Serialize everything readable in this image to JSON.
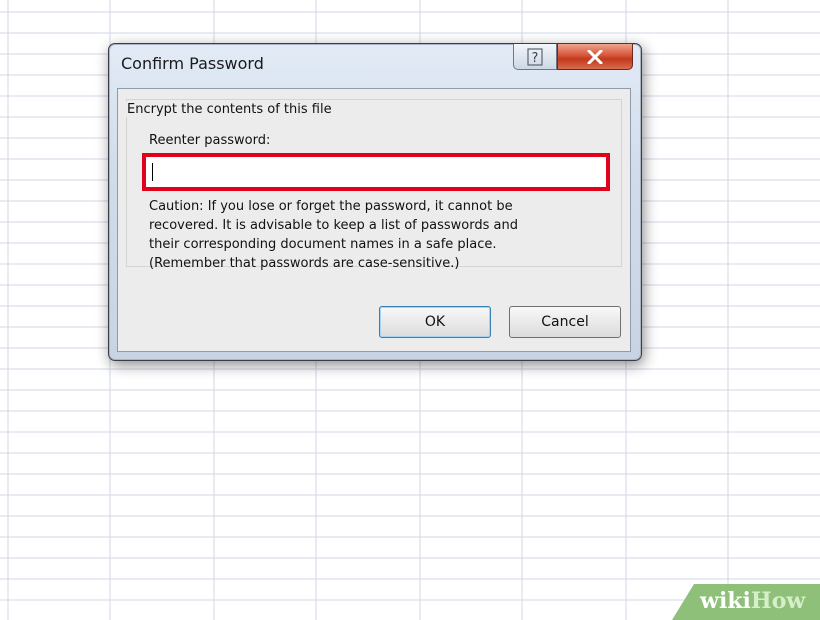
{
  "dialog": {
    "title": "Confirm Password",
    "group_label": "Encrypt the contents of this file",
    "field_label": "Reenter password:",
    "password_value": "",
    "caution_text": "Caution: If you lose or forget the password, it cannot be\nrecovered. It is advisable to keep a list of passwords and\ntheir corresponding document names in a safe place.\n(Remember that passwords are case-sensitive.)",
    "ok_label": "OK",
    "cancel_label": "Cancel",
    "help_icon": "help-icon",
    "close_icon": "close-icon"
  },
  "highlight_color": "#e3001b",
  "watermark": {
    "wiki": "wiki",
    "how": "How"
  }
}
